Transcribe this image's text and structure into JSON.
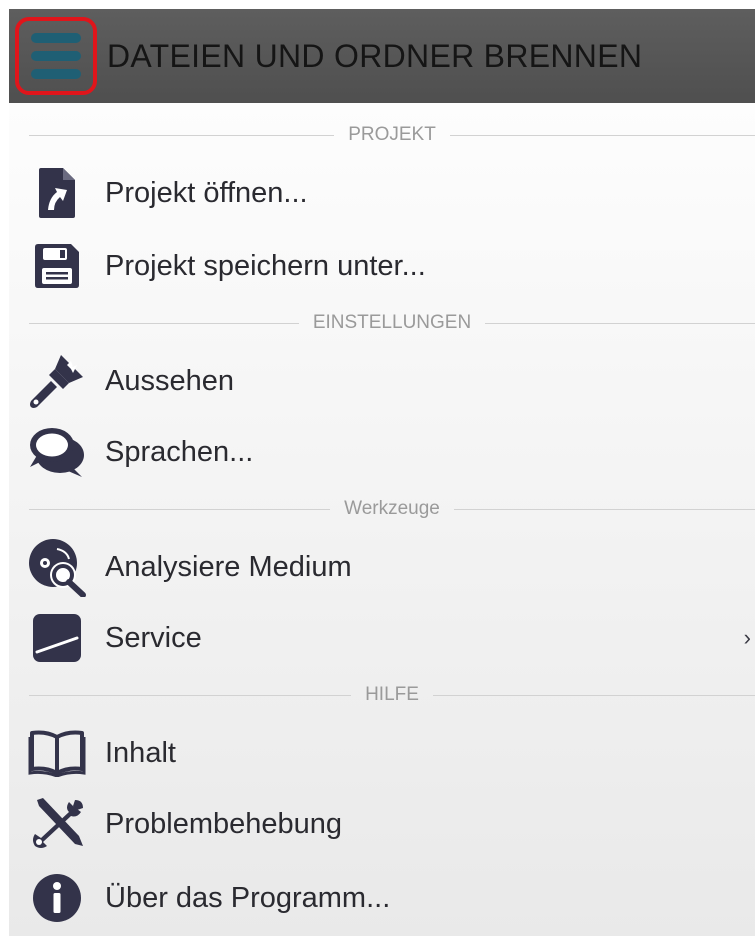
{
  "titlebar": {
    "title": "DATEIEN UND ORDNER BRENNEN",
    "menu_icon": "hamburger-menu-icon",
    "highlight_color": "#e0151b",
    "background": "#555555"
  },
  "sections": [
    {
      "label": "PROJEKT"
    },
    {
      "label": "EINSTELLUNGEN"
    },
    {
      "label": "Werkzeuge"
    },
    {
      "label": "HILFE"
    }
  ],
  "items": [
    {
      "label": "Projekt öffnen...",
      "icon": "open-project-icon"
    },
    {
      "label": "Projekt speichern unter...",
      "icon": "save-floppy-icon"
    },
    {
      "label": "Aussehen",
      "icon": "paintbrush-icon"
    },
    {
      "label": "Sprachen...",
      "icon": "speech-bubbles-icon"
    },
    {
      "label": "Analysiere Medium",
      "icon": "disc-magnifier-icon"
    },
    {
      "label": "Service",
      "icon": "service-icon",
      "submenu": true
    },
    {
      "label": "Inhalt",
      "icon": "book-icon"
    },
    {
      "label": "Problembehebung",
      "icon": "tools-icon"
    },
    {
      "label": "Über das Programm...",
      "icon": "info-icon"
    }
  ],
  "colors": {
    "icon": "#33334a",
    "text": "#2a2a30",
    "section_text": "#9a9a9a",
    "hamburger": "#1f5f74"
  }
}
